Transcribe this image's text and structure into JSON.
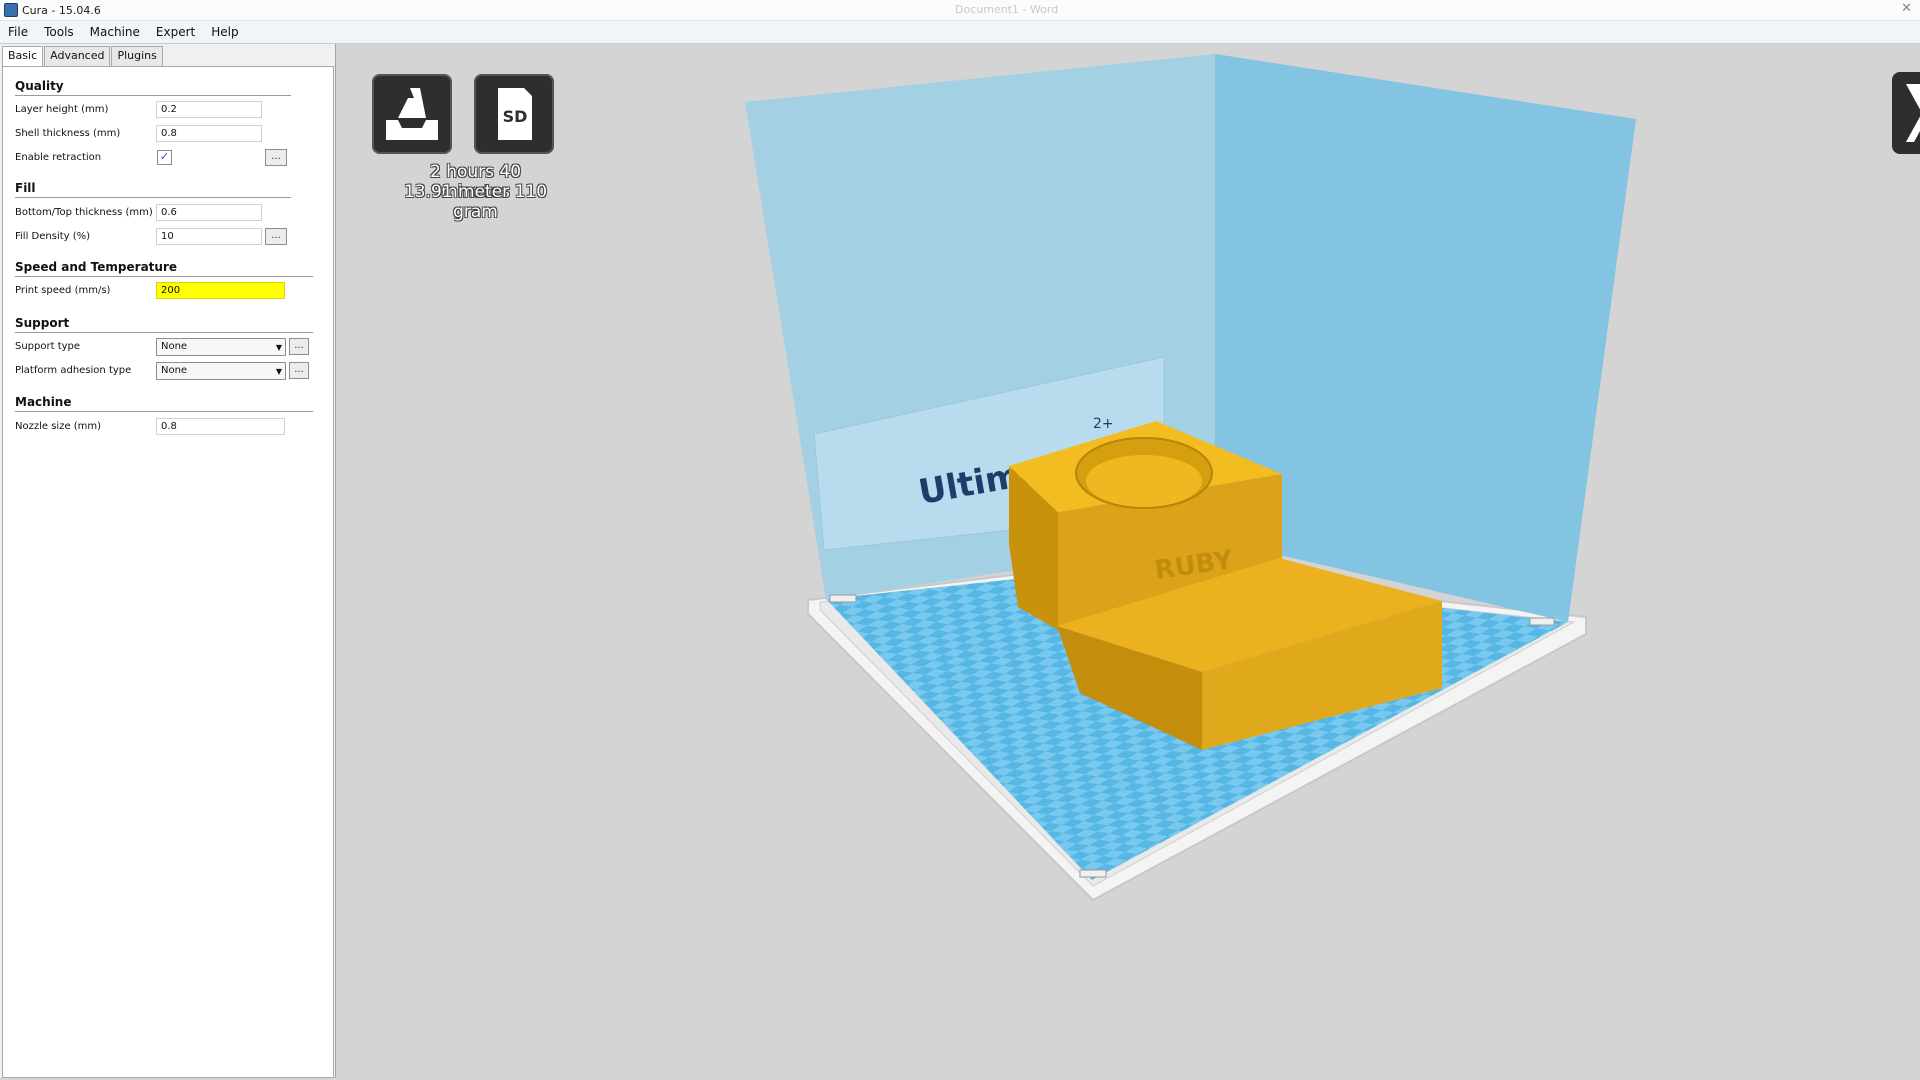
{
  "window": {
    "title": "Cura - 15.04.6",
    "faded_title": "Document1 - Word"
  },
  "menu": [
    "File",
    "Tools",
    "Machine",
    "Expert",
    "Help"
  ],
  "tabs": [
    "Basic",
    "Advanced",
    "Plugins"
  ],
  "sections": {
    "quality": {
      "title": "Quality",
      "layer_height_label": "Layer height (mm)",
      "layer_height_value": "0.2",
      "shell_thickness_label": "Shell thickness (mm)",
      "shell_thickness_value": "0.8",
      "enable_retraction_label": "Enable retraction",
      "enable_retraction_checked": true
    },
    "fill": {
      "title": "Fill",
      "bottom_top_label": "Bottom/Top thickness (mm)",
      "bottom_top_value": "0.6",
      "fill_density_label": "Fill Density (%)",
      "fill_density_value": "10"
    },
    "speed": {
      "title": "Speed and Temperature",
      "print_speed_label": "Print speed (mm/s)",
      "print_speed_value": "200"
    },
    "support": {
      "title": "Support",
      "support_type_label": "Support type",
      "support_type_value": "None",
      "adhesion_label": "Platform adhesion type",
      "adhesion_value": "None"
    },
    "machine": {
      "title": "Machine",
      "nozzle_label": "Nozzle size (mm)",
      "nozzle_value": "0.8"
    }
  },
  "dots_label": "...",
  "viewport": {
    "sd_label": "SD",
    "estimate_time": "2 hours 40 minutes",
    "estimate_material": "13.91 meter 110 gram",
    "brand_text": "Ultimaker",
    "brand_sup": "2+",
    "model_text": "RUBY",
    "colors": {
      "volume": "#7ec3e3",
      "plate": "#5ab8e6",
      "model": "#e3ad1d",
      "highlight": "#ffff00"
    }
  }
}
